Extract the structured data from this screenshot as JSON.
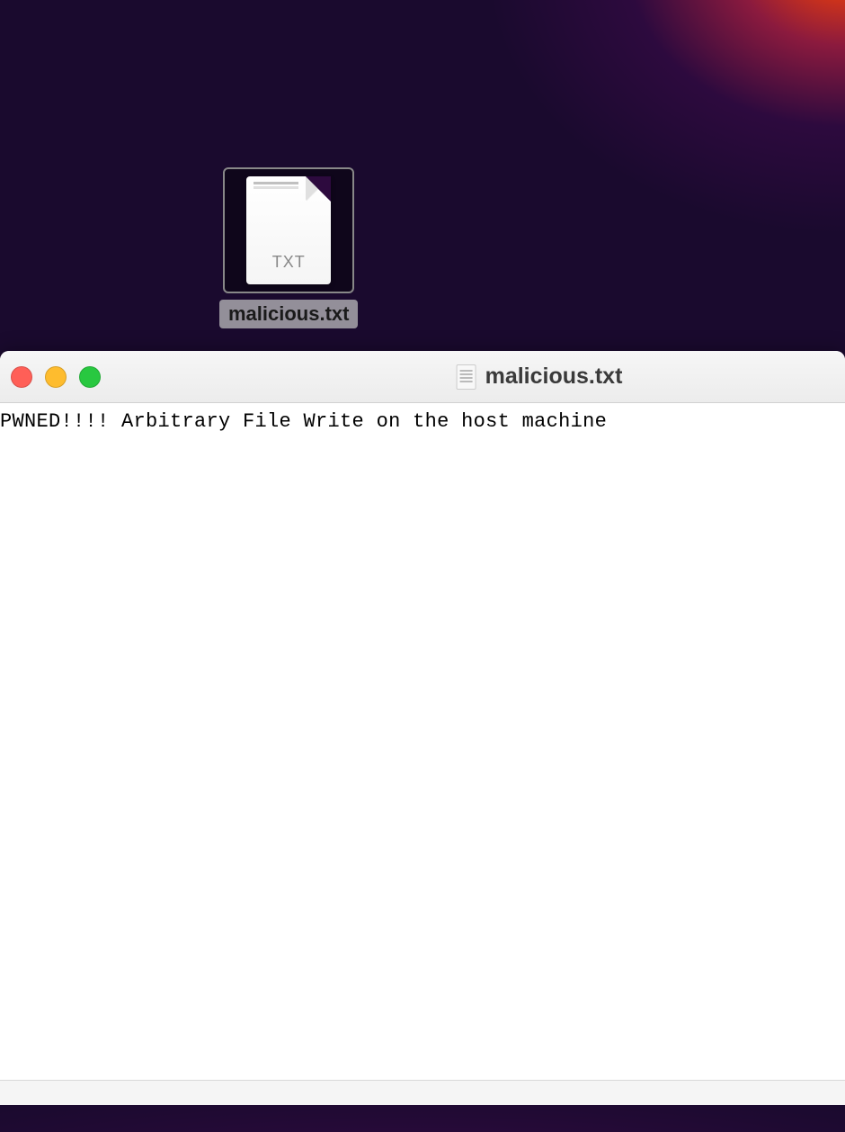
{
  "desktop": {
    "file": {
      "icon_type": "TXT",
      "name": "malicious.txt"
    }
  },
  "window": {
    "title": "malicious.txt",
    "content": "PWNED!!!! Arbitrary File Write on the host machine"
  }
}
